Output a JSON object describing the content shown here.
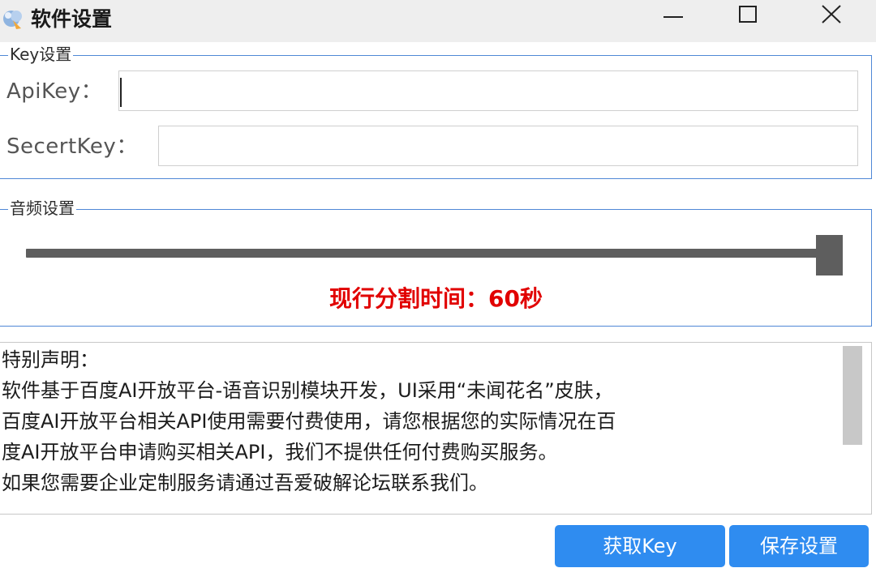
{
  "window": {
    "title": "软件设置",
    "icons": {
      "app": "app-icon",
      "minimize": "minimize-icon",
      "maximize": "maximize-icon",
      "close": "close-icon"
    }
  },
  "key_settings": {
    "title": "Key设置",
    "api_key_label": "ApiKey：",
    "api_key_value": "",
    "secret_key_label": "SecertKey：",
    "secret_key_value": ""
  },
  "audio_settings": {
    "title": "音频设置",
    "slider_value_seconds": 60,
    "slider_fraction": 1.0,
    "split_time_text": "现行分割时间：60秒"
  },
  "notice": {
    "lines": [
      "特别声明：",
      "软件基于百度AI开放平台-语音识别模块开发，UI采用“未闻花名”皮肤，",
      "百度AI开放平台相关API使用需要付费使用，请您根据您的实际情况在百",
      "度AI开放平台申请购买相关API，我们不提供任何付费购买服务。",
      "如果您需要企业定制服务请通过吾爱破解论坛联系我们。"
    ]
  },
  "buttons": {
    "get_key": "获取Key",
    "save": "保存设置"
  },
  "colors": {
    "accent": "#2f8cf0",
    "group_border": "#4f88d6",
    "warning_text": "#e10000",
    "slider": "#5e5e5e"
  }
}
